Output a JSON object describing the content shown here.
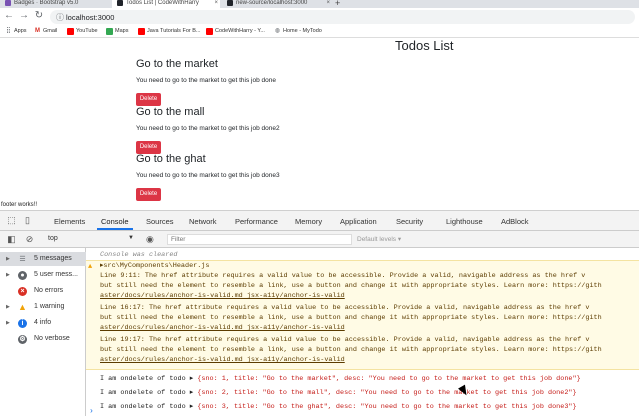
{
  "browser": {
    "tabs": [
      {
        "label": "Badges · Bootstrap v5.0",
        "icon": "bootstrap-icon",
        "color": "#7952b3",
        "active": false
      },
      {
        "label": "Todos List | CodeWithHarry",
        "icon": "react-icon",
        "color": "#20232a",
        "active": true
      },
      {
        "label": "new-source/localhost:3000",
        "icon": "react-icon",
        "color": "#20232a",
        "active": false
      }
    ],
    "url": "localhost:3000",
    "bookmarks": [
      {
        "label": "Apps",
        "icon": "apps-grid-icon"
      },
      {
        "label": "Gmail",
        "icon": "gmail-icon"
      },
      {
        "label": "YouTube",
        "icon": "youtube-icon"
      },
      {
        "label": "Maps",
        "icon": "maps-icon"
      },
      {
        "label": "Java Tutorials For B...",
        "icon": "youtube-icon"
      },
      {
        "label": "CodeWithHarry - Y...",
        "icon": "youtube-icon"
      },
      {
        "label": "Home - MyTodo",
        "icon": "globe-icon"
      }
    ]
  },
  "page": {
    "title": "Todos List",
    "todos": [
      {
        "title": "Go to the market",
        "desc": "You need to go to the market to get this job done",
        "delete_label": "Delete"
      },
      {
        "title": "Go to the mall",
        "desc": "You need to go to the market to get this job done2",
        "delete_label": "Delete"
      },
      {
        "title": "Go to the ghat",
        "desc": "You need to go to the market to get this job done3",
        "delete_label": "Delete"
      }
    ],
    "footer": "footer works!!"
  },
  "devtools": {
    "tabs": [
      "Elements",
      "Console",
      "Sources",
      "Network",
      "Performance",
      "Memory",
      "Application",
      "Security",
      "Lighthouse",
      "AdBlock"
    ],
    "active_tab": "Console",
    "context": "top",
    "filter_placeholder": "Filter",
    "levels_label": "Default levels ▾",
    "sidebar": [
      {
        "label": "5 messages",
        "icon": "list-icon",
        "color": "#5f6368"
      },
      {
        "label": "5 user mess...",
        "icon": "user-icon",
        "color": "#5f6368"
      },
      {
        "label": "No errors",
        "icon": "error-icon",
        "color": "#d93025"
      },
      {
        "label": "1 warning",
        "icon": "warning-icon",
        "color": "#f0a30a"
      },
      {
        "label": "4 info",
        "icon": "info-icon",
        "color": "#1a73e8"
      },
      {
        "label": "No verbose",
        "icon": "verbose-icon",
        "color": "#5f6368"
      }
    ],
    "console": {
      "cleared": "Console was cleared",
      "warning_file": "▸src\\MyComponents\\Header.js",
      "warning_lines": [
        "  Line 9:11:   The href attribute requires a valid value to be accessible. Provide a valid, navigable address as the href v",
        "but still need the element to resemble a link, use a button and change it with appropriate styles. Learn more: https://gith",
        "aster/docs/rules/anchor-is-valid.md  jsx-a11y/anchor-is-valid",
        "  Line 16:17:  The href attribute requires a valid value to be accessible. Provide a valid, navigable address as the href v",
        "but still need the element to resemble a link, use a button and change it with appropriate styles. Learn more: https://gith",
        "aster/docs/rules/anchor-is-valid.md  jsx-a11y/anchor-is-valid",
        "  Line 19:17:  The href attribute requires a valid value to be accessible. Provide a valid, navigable address as the href v",
        "but still need the element to resemble a link, use a button and change it with appropriate styles. Learn more: https://gith",
        "aster/docs/rules/anchor-is-valid.md  jsx-a11y/anchor-is-valid"
      ],
      "logs": [
        {
          "prefix": "I am ondelete of todo ▸",
          "body": "{sno: 1, title: \"Go to the market\", desc: \"You need to go to the market to get this job done\"}"
        },
        {
          "prefix": "I am ondelete of todo ▸",
          "body": "{sno: 2, title: \"Go to the mall\", desc: \"You need to go to the market to get this job done2\"}"
        },
        {
          "prefix": "I am ondelete of todo ▸",
          "body": "{sno: 3, title: \"Go to the ghat\", desc: \"You need to go to the market to get this job done3\"}"
        }
      ],
      "prompt": "›"
    }
  }
}
